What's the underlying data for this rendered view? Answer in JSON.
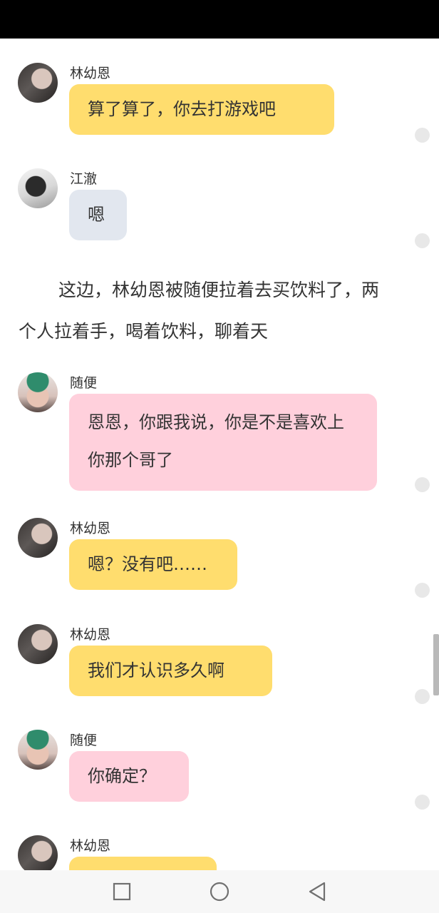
{
  "messages": [
    {
      "sender": "林幼恩",
      "text": "算了算了，你去打游戏吧",
      "avatar": "lin-youen-avatar",
      "color": "#ffdd6e"
    },
    {
      "sender": "江澈",
      "text": "嗯",
      "avatar": "jiang-che-avatar",
      "color": "#e2e7ef"
    },
    {
      "sender": "随便",
      "text": "恩恩，你跟我说，你是不是喜欢上你那个哥了",
      "avatar": "suibian-avatar",
      "color": "#ffd0dc"
    },
    {
      "sender": "林幼恩",
      "text": "嗯？没有吧……",
      "avatar": "lin-youen-avatar",
      "color": "#ffdd6e"
    },
    {
      "sender": "林幼恩",
      "text": "我们才认识多久啊",
      "avatar": "lin-youen-avatar",
      "color": "#ffdd6e"
    },
    {
      "sender": "随便",
      "text": "你确定？",
      "avatar": "suibian-avatar",
      "color": "#ffd0dc"
    },
    {
      "sender": "林幼恩",
      "text": "",
      "avatar": "lin-youen-avatar",
      "color": "#ffdd6e"
    }
  ],
  "narration": "这边，林幼恩被随便拉着去买饮料了，两个人拉着手，喝着饮料，聊着天",
  "nav_bar": {
    "icons": [
      "recent-apps-icon",
      "home-icon",
      "back-icon"
    ]
  }
}
